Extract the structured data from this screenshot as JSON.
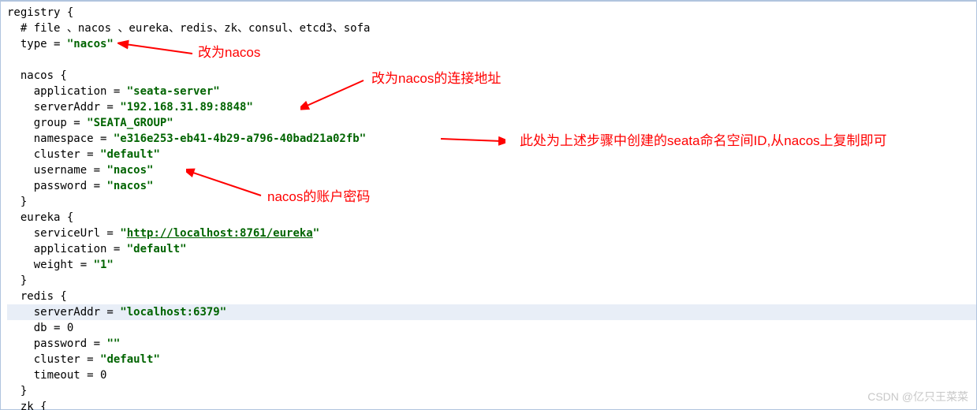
{
  "code": {
    "l1": "registry {",
    "l2": "  # file 、nacos 、eureka、redis、zk、consul、etcd3、sofa",
    "l3a": "  type = ",
    "l3b": "\"nacos\"",
    "l4a": "    application = ",
    "l4b": "\"seata-server\"",
    "l5a": "    serverAddr = ",
    "l5b": "\"192.168.31.89:8848\"",
    "l6a": "    group = ",
    "l6b": "\"SEATA_GROUP\"",
    "l7a": "    namespace = ",
    "l7b": "\"e316e253-eb41-4b29-a796-40bad21a02fb\"",
    "l8a": "    cluster = ",
    "l8b": "\"default\"",
    "l9a": "    username = ",
    "l9b": "\"nacos\"",
    "l10a": "    password = ",
    "l10b": "\"nacos\"",
    "nacos_open": "  nacos {",
    "close": "  }",
    "eureka_open": "  eureka {",
    "e1a": "    serviceUrl = ",
    "e1b": "\"http://localhost:8761/eureka\"",
    "e2a": "    application = ",
    "e2b": "\"default\"",
    "e3a": "    weight = ",
    "e3b": "\"1\"",
    "redis_open": "  redis {",
    "r1a": "    serverAddr = ",
    "r1b": "\"localhost:6379\"",
    "r2": "    db = 0",
    "r3a": "    password = ",
    "r3b": "\"\"",
    "r4a": "    cluster = ",
    "r4b": "\"default\"",
    "r5": "    timeout = 0",
    "zk_open": "  zk {"
  },
  "annotations": {
    "a1": "改为nacos",
    "a2": "改为nacos的连接地址",
    "a3": "此处为上述步骤中创建的seata命名空间ID,从nacos上复制即可",
    "a4": "nacos的账户密码"
  },
  "watermark": "CSDN @亿只王菜菜",
  "colors": {
    "annotation": "#ff0000",
    "string": "#006400",
    "highlight": "#e8eef7"
  }
}
